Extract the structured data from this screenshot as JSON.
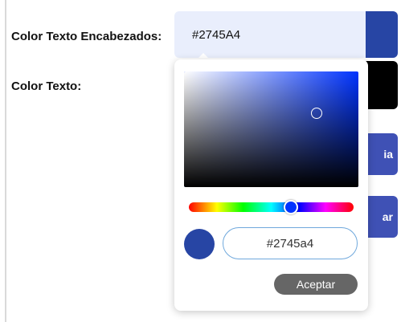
{
  "form": {
    "label_headers": "Color Texto Encabezados:",
    "label_text": "Color Texto:",
    "headers_hex_value": "#2745A4"
  },
  "side_buttons": {
    "button_1_fragment": "ia",
    "button_2_fragment": "ar"
  },
  "colors": {
    "headers_color": "#2745A4",
    "text_color": "#000000",
    "button_color": "#3f51b5",
    "sv_base_hue": "#0033ff"
  },
  "color_picker": {
    "saturation_pct": 76,
    "brightness_pct": 64,
    "hue_pct": 62,
    "input_value": "#2745a4",
    "accept_label": "Aceptar"
  }
}
